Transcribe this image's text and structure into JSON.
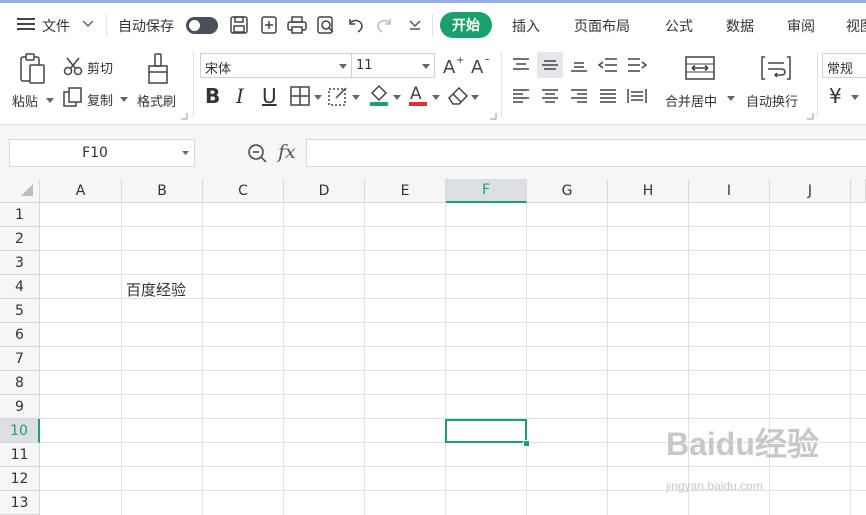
{
  "menu": {
    "file_label": "文件",
    "autosave_label": "自动保存",
    "tabs": [
      "开始",
      "插入",
      "页面布局",
      "公式",
      "数据",
      "审阅",
      "视图"
    ]
  },
  "ribbon": {
    "paste": "粘贴",
    "cut": "剪切",
    "copy": "复制",
    "format_painter": "格式刷",
    "font_name": "宋体",
    "font_size": "11",
    "bold": "B",
    "italic": "I",
    "underline": "U",
    "merge_center": "合并居中",
    "wrap_text": "自动换行",
    "number_format": "常规",
    "currency": "¥"
  },
  "formula_bar": {
    "name_box": "F10",
    "fx": "fx",
    "value": ""
  },
  "sheet": {
    "columns": [
      "A",
      "B",
      "C",
      "D",
      "E",
      "F",
      "G",
      "H",
      "I",
      "J"
    ],
    "rows": [
      "1",
      "2",
      "3",
      "4",
      "5",
      "6",
      "7",
      "8",
      "9",
      "10",
      "11",
      "12",
      "13"
    ],
    "selected_column": "F",
    "selected_row": "10",
    "cell_B4": "百度经验"
  },
  "watermark": {
    "brand": "Baidu经验",
    "url": "jingyan.baidu.com"
  },
  "colors": {
    "accent": "#1aa06d",
    "toggle": "#4a4f5a"
  }
}
